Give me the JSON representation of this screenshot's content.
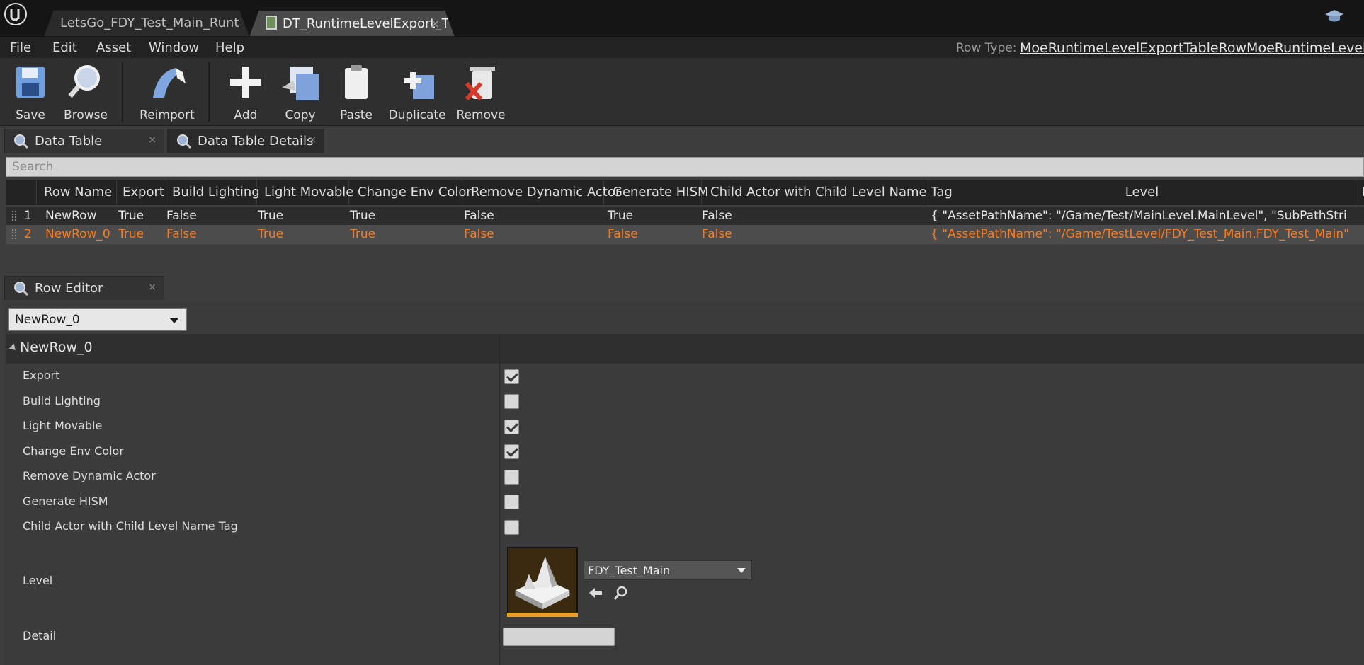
{
  "window": {
    "tabs": [
      {
        "label": "LetsGo_FDY_Test_Main_Runt"
      },
      {
        "label": "DT_RuntimeLevelExport_T"
      }
    ],
    "tab_close_glyph": "×"
  },
  "menu": {
    "items": [
      "File",
      "Edit",
      "Asset",
      "Window",
      "Help"
    ],
    "row_type_label": "Row Type:",
    "row_type_value": "MoeRuntimeLevelExportTableRowMoeRuntimeLevelExp"
  },
  "toolbar": {
    "save": "Save",
    "browse": "Browse",
    "reimport": "Reimport",
    "add": "Add",
    "copy": "Copy",
    "paste": "Paste",
    "duplicate": "Duplicate",
    "remove": "Remove"
  },
  "panels": {
    "data_table_tab": "Data Table",
    "data_table_details_tab": "Data Table Details",
    "row_editor_tab": "Row Editor",
    "close_glyph": "×"
  },
  "search": {
    "placeholder": "Search"
  },
  "table": {
    "columns": [
      "Row Name",
      "Export",
      "Build Lighting",
      "Light Movable",
      "Change Env Color",
      "Remove Dynamic Actor",
      "Generate HISM",
      "Child Actor with Child Level Name Tag",
      "Level",
      "D"
    ],
    "rows": [
      {
        "index": "1",
        "row_name": "NewRow",
        "export": "True",
        "build_lighting": "False",
        "light_movable": "True",
        "change_env_color": "True",
        "remove_dynamic_actor": "False",
        "generate_hism": "True",
        "child_actor": "False",
        "level": "{ \"AssetPathName\": \"/Game/Test/MainLevel.MainLevel\", \"SubPathString\":"
      },
      {
        "index": "2",
        "row_name": "NewRow_0",
        "export": "True",
        "build_lighting": "False",
        "light_movable": "True",
        "change_env_color": "True",
        "remove_dynamic_actor": "False",
        "generate_hism": "False",
        "child_actor": "False",
        "level": "{ \"AssetPathName\": \"/Game/TestLevel/FDY_Test_Main.FDY_Test_Main\", \"S"
      }
    ],
    "selected_row_color": "#ff7a1a"
  },
  "row_editor": {
    "selected_row": "NewRow_0",
    "category": "NewRow_0",
    "properties": [
      {
        "label": "Export",
        "checked": true
      },
      {
        "label": "Build Lighting",
        "checked": false
      },
      {
        "label": "Light Movable",
        "checked": true
      },
      {
        "label": "Change Env Color",
        "checked": true
      },
      {
        "label": "Remove Dynamic Actor",
        "checked": false
      },
      {
        "label": "Generate HISM",
        "checked": false
      },
      {
        "label": "Child Actor with Child Level Name Tag",
        "checked": false
      }
    ],
    "level_label": "Level",
    "level_asset": "FDY_Test_Main",
    "detail_label": "Detail"
  },
  "icons": {
    "logo": "unreal-logo-icon",
    "cap": "graduation-cap-icon",
    "info": "info-magnifier-icon",
    "use": "arrow-left-icon",
    "browse": "magnifier-icon"
  }
}
